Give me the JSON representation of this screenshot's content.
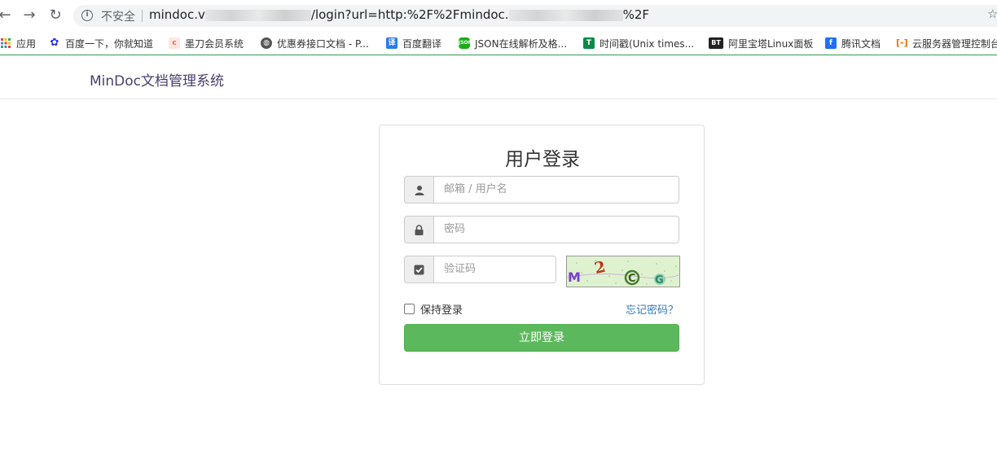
{
  "browser": {
    "security_label": "不安全",
    "url_prefix": "mindoc.v",
    "url_middle": "/login?url=http:%2F%2Fmindoc.",
    "url_suffix": "%2F"
  },
  "bookmarks": [
    {
      "label": "应用",
      "icon": "apps-grid-icon",
      "color": "#e94235"
    },
    {
      "label": "百度一下，你就知道",
      "icon": "baidu-paw-icon",
      "color": "#2932e1"
    },
    {
      "label": "墨刀会员系统",
      "icon": "modao-icon",
      "color": "#f36b4b"
    },
    {
      "label": "优惠券接口文档 - P...",
      "icon": "globe-icon",
      "color": "#555555"
    },
    {
      "label": "百度翻译",
      "icon": "translate-icon",
      "color": "#2b7be5"
    },
    {
      "label": "JSON在线解析及格...",
      "icon": "json-icon",
      "color": "#1aad19"
    },
    {
      "label": "时间戳(Unix times...",
      "icon": "timestamp-icon",
      "color": "#0a8a4a"
    },
    {
      "label": "阿里宝塔Linux面板",
      "icon": "bt-icon",
      "color": "#222222"
    },
    {
      "label": "腾讯文档",
      "icon": "tencent-docs-icon",
      "color": "#1e6fff"
    },
    {
      "label": "云服务器管理控制台",
      "icon": "aliyun-icon",
      "color": "#ff6a00"
    }
  ],
  "header": {
    "brand": "MinDoc文档管理系统"
  },
  "login": {
    "title": "用户登录",
    "account_placeholder": "邮箱 / 用户名",
    "password_placeholder": "密码",
    "captcha_placeholder": "验证码",
    "captcha_text": "M2CG",
    "remember_label": "保持登录",
    "forgot_label": "忘记密码？",
    "submit_label": "立即登录"
  },
  "colors": {
    "primary_button": "#5cb85c",
    "link": "#337ab7",
    "brand": "#4a3f6b"
  }
}
